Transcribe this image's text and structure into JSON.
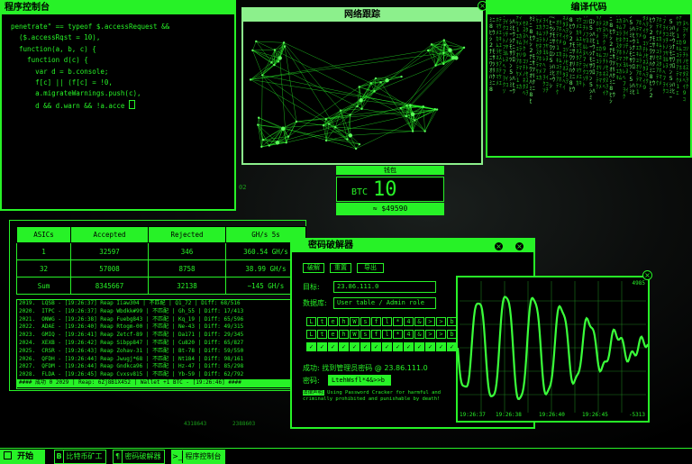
{
  "console": {
    "title": "程序控制台",
    "lines": [
      "penetrate\" == typeof $.accessRequest &&",
      "  ($.accessRqst = 10),",
      "  function(a, b, c) {",
      "    function d(c) {",
      "      var d = b.console;",
      "      f[c] || (f[c] = !0,",
      "      a.migrateWarnings.push(c),",
      "      d && d.warn && !a.acce"
    ]
  },
  "network": {
    "title": "网络跟踪"
  },
  "matrix": {
    "title": "编译代码",
    "columns": [
      "ﾊｸﾐﾆ8ﾋｳｼ2ﾅﾓﾆｻﾜﾂｵﾘ",
      "ｱﾎﾃﾏｹﾒｴｶｷﾑﾕﾗｾﾈｽﾀ",
      "ﾇﾍ7ｦｲｸｺｿﾁﾄﾉﾌﾔﾖﾙﾚ",
      "ﾛﾝ5ｼﾊﾐﾋｰｳｼﾅﾓﾆｻﾜﾂ",
      "ｵﾘｱﾎﾃﾏｹﾒ1ｴｶｷﾑﾕﾗ",
      "ｾﾈｽﾀﾇﾍｦｲｸ9ｺｿﾁﾄﾉ"
    ]
  },
  "wallet": {
    "label": "钱包",
    "currency": "BTC",
    "amount": "10",
    "fiat": "≈ $49590"
  },
  "miner": {
    "columns": [
      "ASICs",
      "Accepted",
      "Rejected",
      "GH/s 5s"
    ],
    "rows": [
      [
        "1",
        "32597",
        "346",
        "360.54 GH/s"
      ],
      [
        "32",
        "57008",
        "8758",
        "38.99 GH/s"
      ],
      [
        "Sum",
        "8345667",
        "32138",
        "~145 GH/s"
      ]
    ],
    "log": [
      "2019.  LQSB - [19:26:37] Reap Iiaw304 | 不匹配 | Q1_72 | Diff: 68/516",
      "2020.  ITPC - [19:26:37] Reap Wbdkk#99 | 不匹配 | Gh_55 | Diff: 17/413",
      "2021.  ONWG - [19:26:38] Reap Fuebg843 | 不匹配 | Kq_19 | Diff: 65/596",
      "2022.  ADAE - [19:26:40] Reap Rtogm-00 | 不匹配 | Ne-43 | Diff: 49/315",
      "2023.  GMIQ - [19:26:41] Reap Zetcf-89 | 不匹配 | Da171 | Diff: 29/345",
      "2024.  XEXB - [19:26:42] Reap Sibpp847 | 不匹配 | Cu820 | Diff: 65/827",
      "2025.  CRSR - [19:26:43] Reap Zohav-31 | 不匹配 | Bt-78 | Diff: 59/550",
      "2026.  QFDH - [19:26:44] Reap Jwugj*68 | 不匹配 | Nt184 | Diff: 98/161",
      "2027.  QFDM - [19:26:44] Reap Gndkca96 | 不匹配 | Hz-47 | Diff: 85/298",
      "2028.  FLDA - [19:26:45] Reap Cvxsv815 | 不匹配 | Yb-59 | Diff: 62/792",
      "#### 成功 0 2029 | Reap: 6Zj8B1X452 | Wallet +1 BTC - [19:26:46] ####"
    ]
  },
  "cracker": {
    "title": "密码破解器",
    "tabs": [
      "破解",
      "重置",
      "导出"
    ],
    "target_label": "目标:",
    "target_value": "23.86.111.0",
    "db_label": "数据库:",
    "db_value": "User table / Admin role",
    "row1": [
      "L",
      "t",
      "e",
      "h",
      "W",
      "s",
      "f",
      "l",
      "*",
      "4",
      "&",
      ">",
      ">",
      "b"
    ],
    "row2": [
      "L",
      "t",
      "e",
      "h",
      "W",
      "s",
      "f",
      "l",
      "*",
      "4",
      "&",
      ">",
      ">",
      "b"
    ],
    "row3": [
      "✓",
      "✓",
      "✓",
      "✓",
      "✓",
      "✓",
      "✓",
      "✓",
      "✓",
      "✓",
      "✓",
      "✓",
      "✓",
      "✓"
    ],
    "success_label": "成功: 找到管理员密码 @ 23.86.111.0",
    "password_label": "密码:",
    "password_value": "LtehWsfl*4&>>b",
    "legal_label": "法律声明:",
    "legal_text": "Using Password Cracker for harmful and criminally prohibited and punishable by death!"
  },
  "oscilloscope": {
    "value_top": "4985",
    "time_left": "19:26:37",
    "time_mid1": "19:26:38",
    "time_mid2": "19:26:40",
    "time_mid3": "19:26:45",
    "value_bottom": "-5313"
  },
  "bottom_values": [
    "4318643",
    "2388603"
  ],
  "side_number": "02",
  "taskbar": {
    "start": "开始",
    "items": [
      {
        "icon": "B",
        "label": "比特币矿工"
      },
      {
        "icon": "¶",
        "label": "密码破解器"
      },
      {
        "icon": ">_",
        "label": "程序控制台"
      }
    ]
  }
}
